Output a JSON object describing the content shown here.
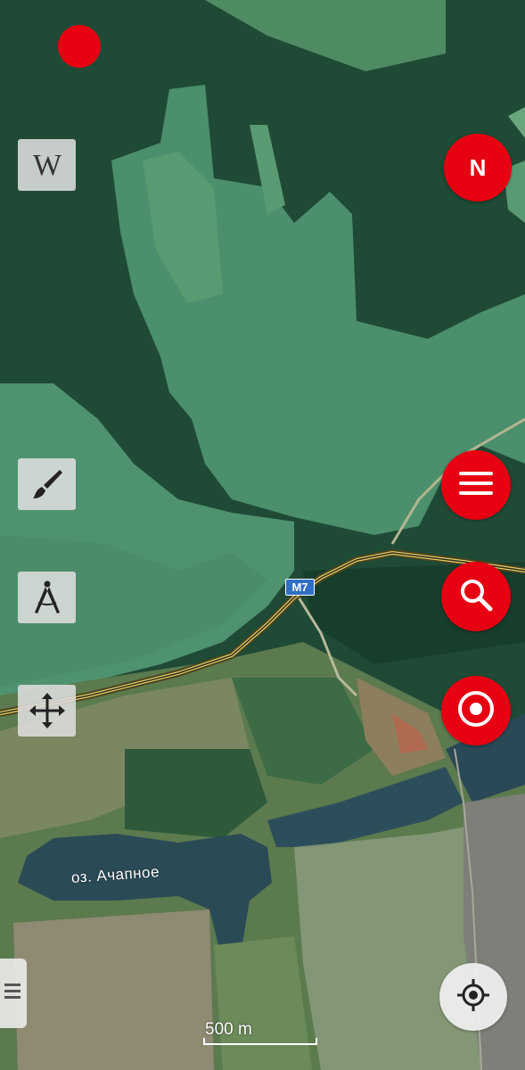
{
  "map": {
    "type": "satellite",
    "road_label": "M7",
    "lake_label": "оз. Ачапное",
    "scale_label": "500 m"
  },
  "controls": {
    "compass_label": "N",
    "left_buttons": [
      "wikipedia-icon",
      "brush-icon",
      "compass-tool-icon",
      "move-arrows-icon"
    ],
    "right_buttons": [
      "menu-icon",
      "search-icon",
      "target-icon"
    ],
    "locate_button": "crosshair-icon"
  },
  "colors": {
    "accent": "#e60012",
    "road_outline": "#e8d060",
    "button_bg": "#dedede"
  }
}
